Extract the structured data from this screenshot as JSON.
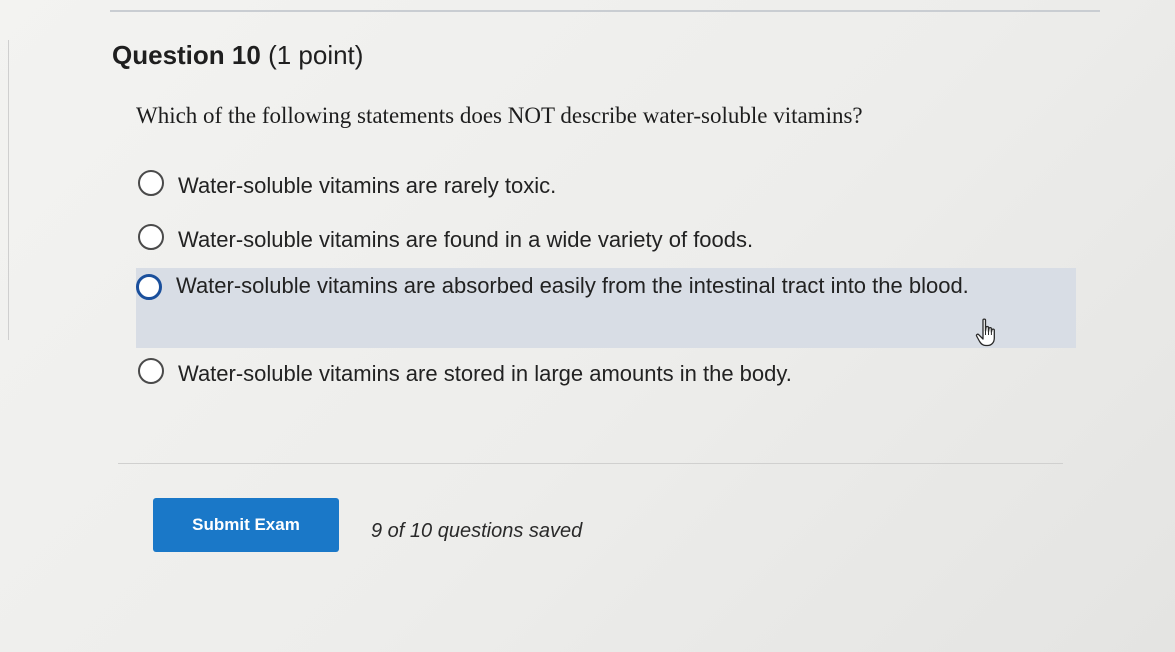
{
  "question": {
    "title": "Question 10",
    "points": "(1 point)",
    "prompt": "Which of the following statements does NOT describe water-soluble vitamins?"
  },
  "options": [
    {
      "label": "Water-soluble vitamins are rarely toxic."
    },
    {
      "label": "Water-soluble vitamins are found in a wide variety of foods."
    },
    {
      "label": "Water-soluble vitamins are absorbed easily from the intestinal tract into the blood."
    },
    {
      "label": "Water-soluble vitamins are stored in large amounts in the body."
    }
  ],
  "footer": {
    "submit_label": "Submit Exam",
    "status": "9 of 10 questions saved"
  },
  "colors": {
    "submit_button": "#1a78c8",
    "highlight_row": "#d8dde5"
  },
  "icons": {
    "cursor": "hand-pointer-icon"
  }
}
